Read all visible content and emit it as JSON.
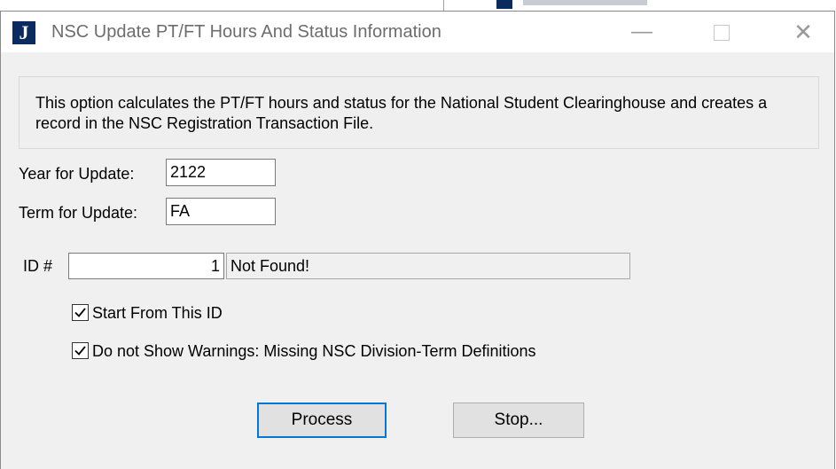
{
  "window": {
    "title": "NSC Update PT/FT Hours And Status Information",
    "icon_letter": "J",
    "minimize_glyph": "—",
    "close_glyph": "✕"
  },
  "info": {
    "text": "This option calculates the PT/FT hours and status for the National Student Clearinghouse and creates a record in the NSC Registration Transaction File."
  },
  "form": {
    "year_label": "Year for Update:",
    "year_value": "2122",
    "term_label": "Term for Update:",
    "term_value": "FA",
    "id_label": "ID #",
    "id_value": "1",
    "id_status": "Not Found!"
  },
  "options": {
    "start_from_id": {
      "label": "Start From This ID",
      "checked": true
    },
    "no_warnings": {
      "label": "Do not Show Warnings: Missing NSC Division-Term Definitions",
      "checked": true
    }
  },
  "buttons": {
    "process": "Process",
    "stop": "Stop..."
  },
  "colors": {
    "accent": "#0078d7",
    "icon_bg": "#0b2a5e",
    "dialog_bg": "#f0f0f0"
  }
}
